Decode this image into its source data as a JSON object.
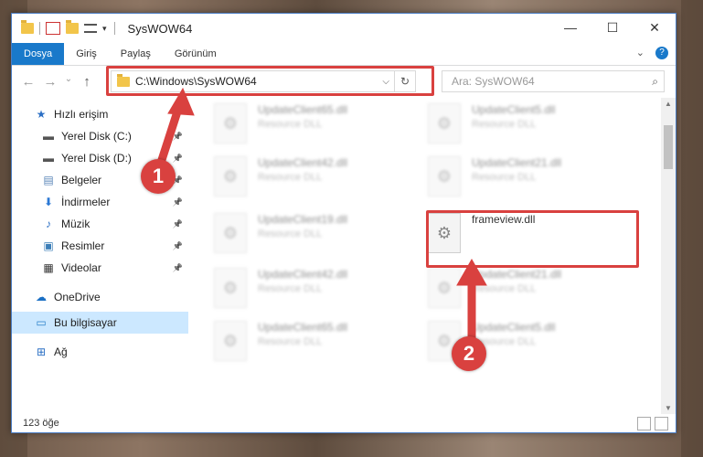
{
  "window": {
    "title": "SysWOW64",
    "controls": {
      "minimize": "—",
      "maximize": "☐",
      "close": "✕"
    }
  },
  "ribbon": {
    "tabs": [
      "Dosya",
      "Giriş",
      "Paylaş",
      "Görünüm"
    ],
    "expand_icon": "chevron-down-icon",
    "help": "?"
  },
  "navigation": {
    "back": "←",
    "forward": "→",
    "recent": "⌄",
    "up": "↑"
  },
  "address": {
    "path": "C:\\Windows\\SysWOW64",
    "dropdown": "⌵",
    "refresh": "↻"
  },
  "search": {
    "placeholder": "Ara: SysWOW64",
    "icon": "⌕"
  },
  "sidebar": {
    "items": [
      {
        "label": "Hızlı erişim",
        "icon": "star-icon",
        "glyph": "★",
        "color": "#2b6fc4",
        "pinned": false
      },
      {
        "label": "Yerel Disk (C:)",
        "icon": "drive-icon",
        "glyph": "▬",
        "color": "#555555",
        "pinned": true
      },
      {
        "label": "Yerel Disk (D:)",
        "icon": "drive-icon",
        "glyph": "▬",
        "color": "#555555",
        "pinned": true
      },
      {
        "label": "Belgeler",
        "icon": "documents-icon",
        "glyph": "▤",
        "color": "#5a86b8",
        "pinned": true
      },
      {
        "label": "İndirmeler",
        "icon": "download-icon",
        "glyph": "⬇",
        "color": "#2b78d4",
        "pinned": true
      },
      {
        "label": "Müzik",
        "icon": "music-icon",
        "glyph": "♪",
        "color": "#2b6fc4",
        "pinned": true
      },
      {
        "label": "Resimler",
        "icon": "pictures-icon",
        "glyph": "▣",
        "color": "#3d7fb8",
        "pinned": true
      },
      {
        "label": "Videolar",
        "icon": "video-icon",
        "glyph": "▦",
        "color": "#333333",
        "pinned": true
      },
      {
        "label": "OneDrive",
        "icon": "cloud-icon",
        "glyph": "☁",
        "color": "#1a6fc4",
        "pinned": false
      },
      {
        "label": "Bu bilgisayar",
        "icon": "computer-icon",
        "glyph": "▭",
        "color": "#2a80c9",
        "pinned": false,
        "selected": true
      },
      {
        "label": "Ağ",
        "icon": "network-icon",
        "glyph": "⊞",
        "color": "#2b6fc4",
        "pinned": false
      }
    ]
  },
  "files": [
    {
      "name": "UpdateClient65.dll",
      "type": "Resource DLL",
      "blurred": true
    },
    {
      "name": "UpdateClient5.dll",
      "type": "Resource DLL",
      "blurred": true
    },
    {
      "name": "UpdateClient42.dll",
      "type": "Resource DLL",
      "blurred": true
    },
    {
      "name": "UpdateClient21.dll",
      "type": "Resource DLL",
      "blurred": true
    },
    {
      "name": "UpdateClient19.dll",
      "type": "Resource DLL",
      "blurred": true
    },
    {
      "name": "frameview.dll",
      "type": "",
      "blurred": false
    },
    {
      "name": "UpdateClient42.dll",
      "type": "Resource DLL",
      "blurred": true
    },
    {
      "name": "UpdateClient21.dll",
      "type": "Resource DLL",
      "blurred": true
    },
    {
      "name": "UpdateClient65.dll",
      "type": "Resource DLL",
      "blurred": true
    },
    {
      "name": "UpdateClient5.dll",
      "type": "Resource DLL",
      "blurred": true
    }
  ],
  "status": {
    "count": "123 öğe"
  },
  "annotations": {
    "step1": "1",
    "step2": "2",
    "highlight_color": "#d9413f"
  }
}
